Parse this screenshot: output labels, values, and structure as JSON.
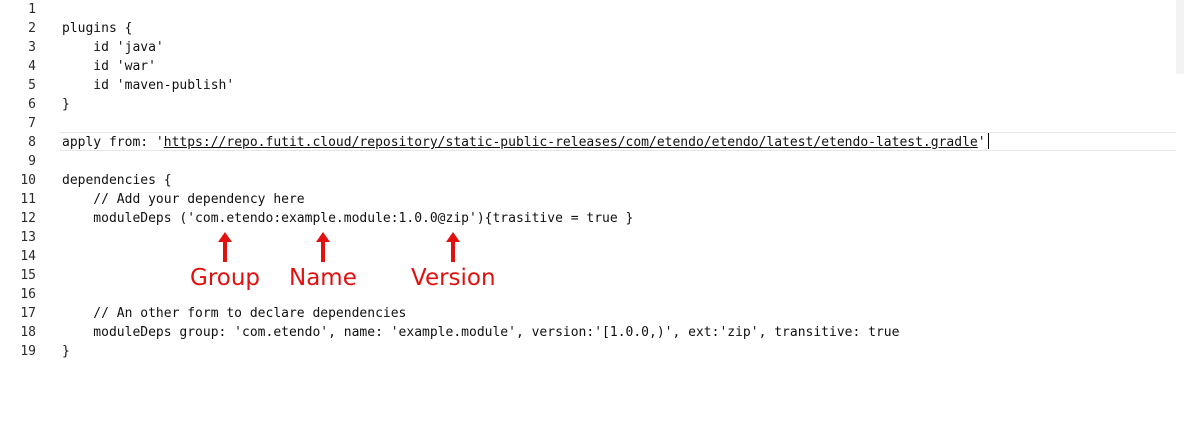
{
  "editor": {
    "line_numbers": [
      "1",
      "2",
      "3",
      "4",
      "5",
      "6",
      "7",
      "8",
      "9",
      "10",
      "11",
      "12",
      "13",
      "14",
      "15",
      "16",
      "17",
      "18",
      "19"
    ],
    "lines": {
      "l2": "plugins {",
      "l3": "    id 'java'",
      "l4": "    id 'war'",
      "l5": "    id 'maven-publish'",
      "l6": "}",
      "l8_prefix": "apply from: '",
      "l8_url": "https://repo.futit.cloud/repository/static-public-releases/com/etendo/etendo/latest/etendo-latest.gradle",
      "l8_suffix": "'",
      "l10": "dependencies {",
      "l11": "    // Add your dependency here",
      "l12": "    moduleDeps ('com.etendo:example.module:1.0.0@zip'){trasitive = true }",
      "l17": "    // An other form to declare dependencies",
      "l18": "    moduleDeps group: 'com.etendo', name: 'example.module', version:'[1.0.0,)', ext:'zip', transitive: true",
      "l19": "}"
    }
  },
  "annotations": {
    "color": "#e0110f",
    "group": "Group",
    "name": "Name",
    "version": "Version"
  }
}
